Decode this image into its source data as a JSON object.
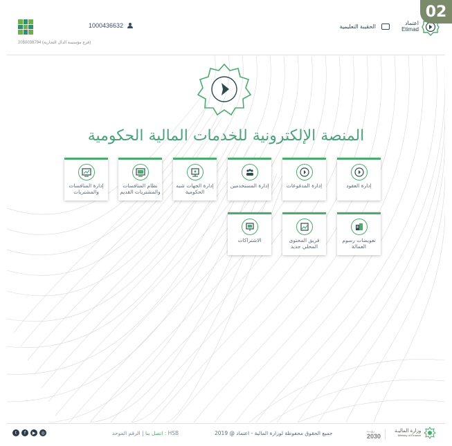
{
  "badge": "02",
  "header": {
    "user_id": "1000436632",
    "org_line": "2050038794 (فرع مؤسسة الدال التجارية)",
    "bag_label": "الحقيبة التعليمية",
    "logo_ar": "اعتماد",
    "logo_en": "Etimad"
  },
  "main_title": "المنصة الإلكترونية للخدمات المالية الحكومية",
  "tiles": [
    {
      "label": "إدارة العقود",
      "icon": "contract-icon"
    },
    {
      "label": "إدارة المدفوعات",
      "icon": "payments-icon"
    },
    {
      "label": "إدارة المستخدمين",
      "icon": "users-icon"
    },
    {
      "label": "إدارة الجهات شبه الحكومية",
      "icon": "semi-gov-icon"
    },
    {
      "label": "نظام المنافسات والمشتريات القديم",
      "icon": "legacy-tenders-icon"
    },
    {
      "label": "إدارة المنافسات والمشتريات",
      "icon": "tenders-icon"
    },
    {
      "label": "تعويضات رسوم العمالة",
      "icon": "labor-fees-icon"
    },
    {
      "label": "فريق المحتوى المحلي جديد",
      "icon": "local-content-icon"
    },
    {
      "label": "الاشتراكات",
      "icon": "subscriptions-icon"
    }
  ],
  "footer": {
    "contact_label": "اتصل بنا",
    "unified_number": "الرقم الموحد : HSB",
    "rights": "جميع الحقوق محفوظة لوزارة المالية - اعتماد @ 2019",
    "vision": "2030",
    "vision_sub": "رؤيـــة",
    "mof_ar": "وزارة الماليـة",
    "mof_en": "Ministry of Finance",
    "social": [
      "twitter-icon",
      "facebook-icon",
      "youtube-icon",
      "instagram-icon"
    ]
  },
  "colors": {
    "accent": "#4bab6c",
    "title": "#4ba27c",
    "badge": "#7a8a6a"
  }
}
